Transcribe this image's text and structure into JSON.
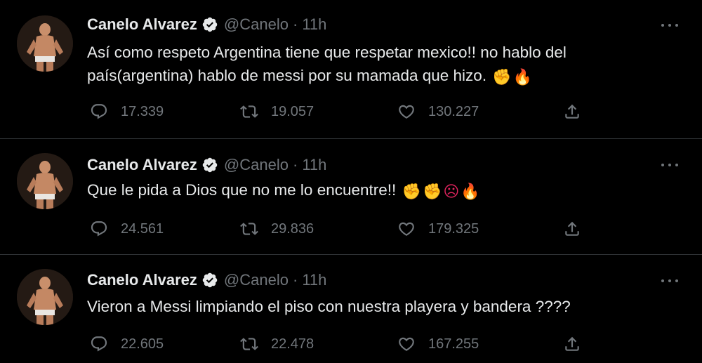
{
  "tweets": [
    {
      "author": {
        "name": "Canelo Alvarez",
        "handle": "@Canelo",
        "verified": true
      },
      "time": "11h",
      "separator": "·",
      "text": "Así como respeto Argentina tiene que respetar mexico!! no hablo del país(argentina) hablo de messi por su mamada que hizo.",
      "emojis": [
        "oncoming-fist",
        "fire"
      ],
      "stats": {
        "replies": "17.339",
        "retweets": "19.057",
        "likes": "130.227"
      }
    },
    {
      "author": {
        "name": "Canelo Alvarez",
        "handle": "@Canelo",
        "verified": true
      },
      "time": "11h",
      "separator": "·",
      "text": "Que le pida a Dios que no me lo encuentre!!",
      "emojis": [
        "oncoming-fist",
        "oncoming-fist",
        "face-with-symbols-on-mouth",
        "fire"
      ],
      "stats": {
        "replies": "24.561",
        "retweets": "29.836",
        "likes": "179.325"
      }
    },
    {
      "author": {
        "name": "Canelo Alvarez",
        "handle": "@Canelo",
        "verified": true
      },
      "time": "11h",
      "separator": "·",
      "text": "Vieron a Messi limpiando el piso con nuestra playera y bandera ????",
      "emojis": [],
      "stats": {
        "replies": "22.605",
        "retweets": "22.478",
        "likes": "167.255"
      }
    }
  ],
  "colors": {
    "background": "#000000",
    "text": "#e7e9ea",
    "muted": "#71767b",
    "divider": "#2f3336",
    "verified_badge": "#e7e9ea"
  },
  "icons": {
    "verified": "verified-badge-icon",
    "more": "more-icon",
    "reply": "reply-icon",
    "retweet": "retweet-icon",
    "like": "heart-icon",
    "share": "share-icon"
  }
}
